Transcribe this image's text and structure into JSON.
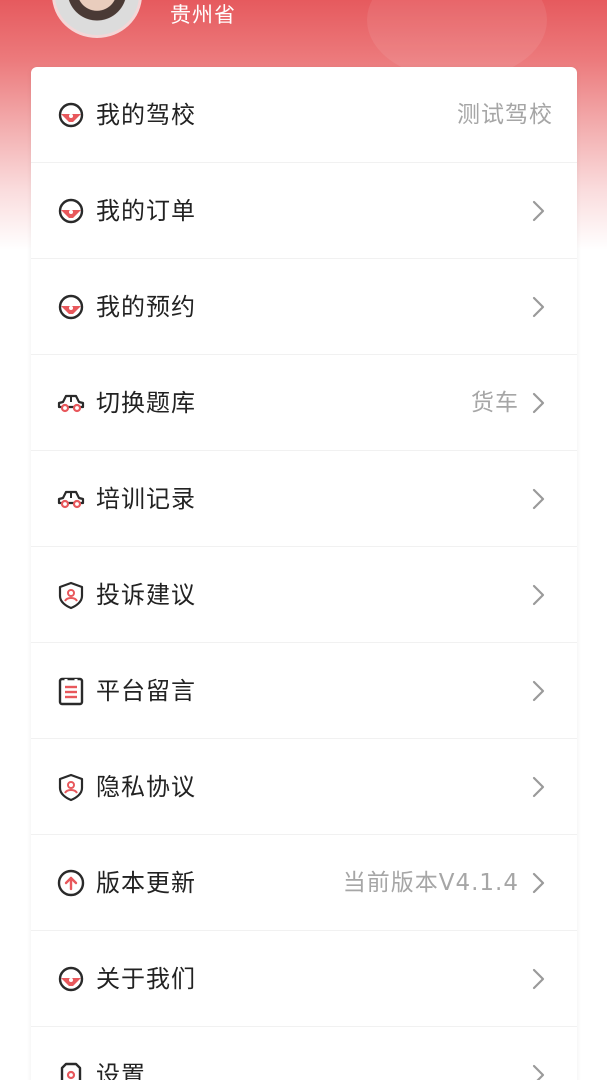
{
  "profile": {
    "province": "贵州省"
  },
  "menu": [
    {
      "label": "我的驾校",
      "value": "测试驾校",
      "icon": "steering-wheel-icon",
      "arrow": false
    },
    {
      "label": "我的订单",
      "value": "",
      "icon": "steering-wheel-icon",
      "arrow": true
    },
    {
      "label": "我的预约",
      "value": "",
      "icon": "steering-wheel-icon",
      "arrow": true
    },
    {
      "label": "切换题库",
      "value": "货车",
      "icon": "car-icon",
      "arrow": true
    },
    {
      "label": "培训记录",
      "value": "",
      "icon": "car-icon",
      "arrow": true
    },
    {
      "label": "投诉建议",
      "value": "",
      "icon": "user-shield-icon",
      "arrow": true
    },
    {
      "label": "平台留言",
      "value": "",
      "icon": "message-board-icon",
      "arrow": true
    },
    {
      "label": "隐私协议",
      "value": "",
      "icon": "user-shield-icon",
      "arrow": true
    },
    {
      "label": "版本更新",
      "value": "当前版本V4.1.4",
      "icon": "upload-arrow-icon",
      "arrow": true
    },
    {
      "label": "关于我们",
      "value": "",
      "icon": "steering-wheel-icon",
      "arrow": true
    },
    {
      "label": "设置",
      "value": "",
      "icon": "settings-icon",
      "arrow": true
    }
  ],
  "colors": {
    "accent": "#e8585c",
    "icon_dark": "#2a2a2a",
    "text": "#222222",
    "muted": "#a6a6a6"
  }
}
